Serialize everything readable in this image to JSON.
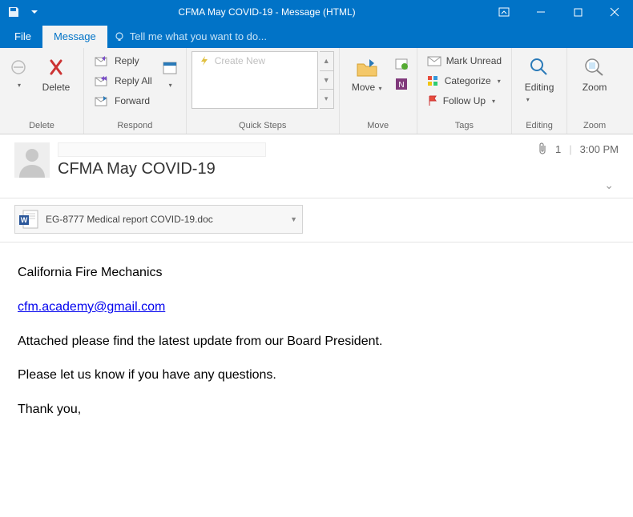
{
  "window": {
    "title": "CFMA May COVID-19 - Message (HTML)"
  },
  "tabs": {
    "file": "File",
    "message": "Message",
    "tellme": "Tell me what you want to do..."
  },
  "ribbon": {
    "delete": {
      "label": "Delete",
      "group": "Delete"
    },
    "respond": {
      "reply": "Reply",
      "replyAll": "Reply All",
      "forward": "Forward",
      "group": "Respond"
    },
    "quicksteps": {
      "createNew": "Create New",
      "group": "Quick Steps"
    },
    "move": {
      "label": "Move",
      "group": "Move"
    },
    "tags": {
      "markUnread": "Mark Unread",
      "categorize": "Categorize",
      "followUp": "Follow Up",
      "group": "Tags"
    },
    "editing": {
      "label": "Editing",
      "group": "Editing"
    },
    "zoom": {
      "label": "Zoom",
      "group": "Zoom"
    }
  },
  "header": {
    "subject": "CFMA May COVID-19",
    "attachmentCount": "1",
    "time": "3:00 PM"
  },
  "attachment": {
    "name": "EG-8777 Medical report COVID-19.doc"
  },
  "body": {
    "line1": "California Fire Mechanics",
    "email": "cfm.academy@gmail.com",
    "line2": "Attached please find the latest update from our Board President.",
    "line3": "Please let us know if you have any questions.",
    "line4": "Thank you,"
  }
}
